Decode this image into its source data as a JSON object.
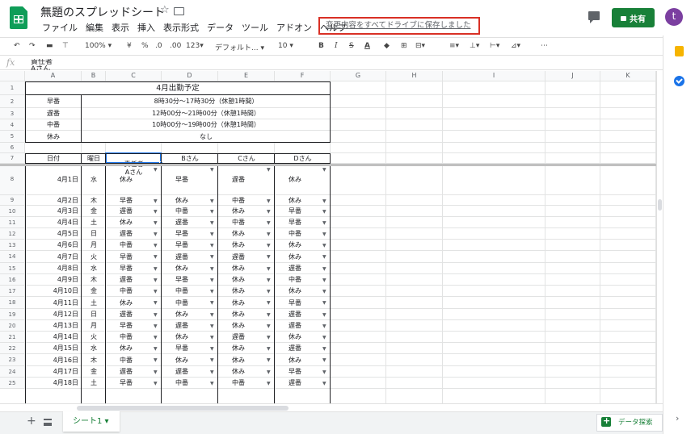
{
  "app": {
    "doc_title": "無題のスプレッドシート",
    "menus": [
      "ファイル",
      "編集",
      "表示",
      "挿入",
      "表示形式",
      "データ",
      "ツール",
      "アドオン",
      "ヘルプ"
    ],
    "save_status": "変更内容をすべてドライブに保存しました",
    "share_label": "共有",
    "avatar_letter": "t",
    "brand_color": "#0f9d58",
    "share_color": "#188038",
    "avatar_color": "#7b3fa0",
    "highlight_color": "#d93025"
  },
  "toolbar": {
    "zoom": "100%",
    "currency": "¥",
    "percent": "%",
    "dec_less": ".0",
    "dec_more": ".00",
    "more_formats": "123",
    "font": "デフォルト...",
    "font_size": "10",
    "bold": "B",
    "italic": "I",
    "strike": "S",
    "text_color": "A",
    "more": "⋯"
  },
  "formula_bar": {
    "fx": "fx",
    "value": "責任者\nAさん"
  },
  "grid": {
    "columns": [
      "A",
      "B",
      "C",
      "D",
      "E",
      "F",
      "G",
      "H",
      "I",
      "J",
      "K"
    ],
    "rows": [
      "1",
      "2",
      "3",
      "4",
      "5",
      "6",
      "7",
      "8",
      "9",
      "10",
      "11",
      "12",
      "13",
      "14",
      "15",
      "16",
      "17",
      "18",
      "19",
      "20",
      "21",
      "22",
      "23",
      "24",
      "25"
    ],
    "title": "4月出勤予定",
    "legend": [
      {
        "name": "早番",
        "time": "8時30分～17時30分（休憩1時間）"
      },
      {
        "name": "遅番",
        "time": "12時00分～21時00分（休憩1時間）"
      },
      {
        "name": "中番",
        "time": "10時00分～19時00分（休憩1時間）"
      },
      {
        "name": "休み",
        "time": "なし"
      }
    ],
    "headers": {
      "date": "日付",
      "weekday": "曜日",
      "lead_line1": "責任者",
      "lead_line2": "Aさん",
      "b": "Bさん",
      "c": "Cさん",
      "d": "Dさん"
    },
    "schedule": [
      {
        "date": "4月1日",
        "day": "水",
        "a": "休み",
        "b": "早番",
        "c": "遅番",
        "d": "休み"
      },
      {
        "date": "4月2日",
        "day": "木",
        "a": "早番",
        "b": "休み",
        "c": "中番",
        "d": "休み"
      },
      {
        "date": "4月3日",
        "day": "金",
        "a": "遅番",
        "b": "中番",
        "c": "休み",
        "d": "早番"
      },
      {
        "date": "4月4日",
        "day": "土",
        "a": "休み",
        "b": "遅番",
        "c": "中番",
        "d": "早番"
      },
      {
        "date": "4月5日",
        "day": "日",
        "a": "遅番",
        "b": "早番",
        "c": "休み",
        "d": "中番"
      },
      {
        "date": "4月6日",
        "day": "月",
        "a": "中番",
        "b": "早番",
        "c": "休み",
        "d": "休み"
      },
      {
        "date": "4月7日",
        "day": "火",
        "a": "早番",
        "b": "遅番",
        "c": "遅番",
        "d": "休み"
      },
      {
        "date": "4月8日",
        "day": "水",
        "a": "早番",
        "b": "休み",
        "c": "休み",
        "d": "遅番"
      },
      {
        "date": "4月9日",
        "day": "木",
        "a": "遅番",
        "b": "早番",
        "c": "休み",
        "d": "中番"
      },
      {
        "date": "4月10日",
        "day": "金",
        "a": "中番",
        "b": "中番",
        "c": "休み",
        "d": "休み"
      },
      {
        "date": "4月11日",
        "day": "土",
        "a": "休み",
        "b": "中番",
        "c": "休み",
        "d": "早番"
      },
      {
        "date": "4月12日",
        "day": "日",
        "a": "遅番",
        "b": "休み",
        "c": "休み",
        "d": "遅番"
      },
      {
        "date": "4月13日",
        "day": "月",
        "a": "早番",
        "b": "遅番",
        "c": "休み",
        "d": "遅番"
      },
      {
        "date": "4月14日",
        "day": "火",
        "a": "中番",
        "b": "休み",
        "c": "遅番",
        "d": "休み"
      },
      {
        "date": "4月15日",
        "day": "水",
        "a": "休み",
        "b": "早番",
        "c": "休み",
        "d": "遅番"
      },
      {
        "date": "4月16日",
        "day": "木",
        "a": "中番",
        "b": "休み",
        "c": "休み",
        "d": "休み"
      },
      {
        "date": "4月17日",
        "day": "金",
        "a": "遅番",
        "b": "遅番",
        "c": "休み",
        "d": "早番"
      },
      {
        "date": "4月18日",
        "day": "土",
        "a": "早番",
        "b": "中番",
        "c": "中番",
        "d": "遅番"
      }
    ]
  },
  "bottom": {
    "add": "+",
    "sheet_name": "シート1 ▾",
    "explore_label": "データ探索"
  }
}
